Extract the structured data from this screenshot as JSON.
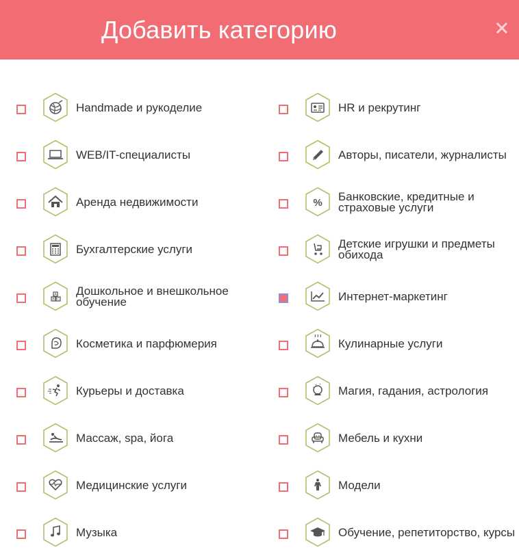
{
  "header": {
    "title": "Добавить категорию",
    "close_icon": "close-icon"
  },
  "colors": {
    "accent": "#f26d73",
    "hex_border": "#a9c56a",
    "icon_gray": "#555555"
  },
  "categories": [
    {
      "label": "Handmade и рукоделие",
      "icon": "yarn-ball-icon",
      "checked": false
    },
    {
      "label": "HR и рекрутинг",
      "icon": "id-card-icon",
      "checked": false
    },
    {
      "label": "WEB/IT-специалисты",
      "icon": "laptop-icon",
      "checked": false
    },
    {
      "label": "Авторы, писатели, журналисты",
      "icon": "pencil-icon",
      "checked": false
    },
    {
      "label": "Аренда недвижимости",
      "icon": "house-icon",
      "checked": false
    },
    {
      "label": "Банковские, кредитные и страховые услуги",
      "icon": "percent-icon",
      "checked": false
    },
    {
      "label": "Бухгалтерские услуги",
      "icon": "calculator-icon",
      "checked": false
    },
    {
      "label": "Детские игрушки и предметы обихода",
      "icon": "stroller-icon",
      "checked": false
    },
    {
      "label": "Дошкольное и внешкольное обучение",
      "icon": "abc-blocks-icon",
      "checked": false
    },
    {
      "label": "Интернет-маркетинг",
      "icon": "chart-line-icon",
      "checked": true
    },
    {
      "label": "Косметика и парфюмерия",
      "icon": "face-icon",
      "checked": false
    },
    {
      "label": "Кулинарные услуги",
      "icon": "cloche-icon",
      "checked": false
    },
    {
      "label": "Курьеры и доставка",
      "icon": "courier-icon",
      "checked": false
    },
    {
      "label": "Магия, гадания, астрология",
      "icon": "crystal-ball-icon",
      "checked": false
    },
    {
      "label": "Массаж, spa, йога",
      "icon": "massage-icon",
      "checked": false
    },
    {
      "label": "Мебель и кухни",
      "icon": "armchair-icon",
      "checked": false
    },
    {
      "label": "Медицинские услуги",
      "icon": "heart-pulse-icon",
      "checked": false
    },
    {
      "label": "Модели",
      "icon": "person-icon",
      "checked": false
    },
    {
      "label": "Музыка",
      "icon": "music-note-icon",
      "checked": false
    },
    {
      "label": "Обучение, репетиторство, курсы",
      "icon": "graduation-cap-icon",
      "checked": false
    }
  ]
}
